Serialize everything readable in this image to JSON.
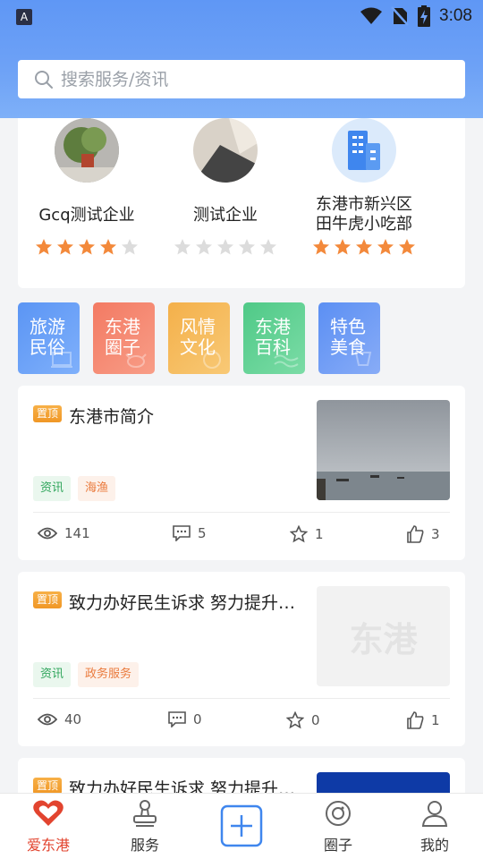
{
  "status_bar": {
    "time": "3:08",
    "icons": [
      "app-indicator-icon",
      "wifi-icon",
      "no-sim-icon",
      "battery-charging-icon"
    ]
  },
  "search": {
    "placeholder": "搜索服务/资讯"
  },
  "companies": [
    {
      "name": "Gcq测试企业",
      "rating": 4,
      "max": 5
    },
    {
      "name": "测试企业",
      "rating": 0,
      "max": 5
    },
    {
      "name_line1": "东港市新兴区",
      "name_line2": "田牛虎小吃部",
      "rating": 5,
      "max": 5
    }
  ],
  "categories": [
    {
      "line1": "旅游",
      "line2": "民俗",
      "color_start": "#5b95f4",
      "color_end": "#7fb0fb"
    },
    {
      "line1": "东港",
      "line2": "圈子",
      "color_start": "#f37a63",
      "color_end": "#f89d87"
    },
    {
      "line1": "风情",
      "line2": "文化",
      "color_start": "#f4b04a",
      "color_end": "#f8c976"
    },
    {
      "line1": "东港",
      "line2": "百科",
      "color_start": "#4fc987",
      "color_end": "#7bdca6"
    },
    {
      "line1": "特色",
      "line2": "美食",
      "color_start": "#5b8ff3",
      "color_end": "#88acf7"
    }
  ],
  "articles": [
    {
      "badge": "置顶",
      "title": "东港市简介",
      "tags": [
        "资讯",
        "海渔"
      ],
      "views": "141",
      "comments": "5",
      "favorites": "1",
      "likes": "3"
    },
    {
      "badge": "置顶",
      "title": "致力办好民生诉求 努力提升…",
      "tags": [
        "资讯",
        "政务服务"
      ],
      "thumb_text": "东港",
      "views": "40",
      "comments": "0",
      "favorites": "0",
      "likes": "1"
    },
    {
      "badge": "置顶",
      "title": "致力办好民生诉求 努力提升…"
    }
  ],
  "tabbar": [
    {
      "label": "爱东港",
      "icon": "heart-icon",
      "active": true
    },
    {
      "label": "服务",
      "icon": "stamp-icon",
      "active": false
    },
    {
      "label": "",
      "icon": "plus-icon",
      "active": false
    },
    {
      "label": "圈子",
      "icon": "smile-circle-icon",
      "active": false
    },
    {
      "label": "我的",
      "icon": "person-icon",
      "active": false
    }
  ],
  "colors": {
    "accent": "#e2442f",
    "header": "#6ea2f6",
    "star_on": "#f3893b",
    "star_off": "#dcdcdc"
  }
}
